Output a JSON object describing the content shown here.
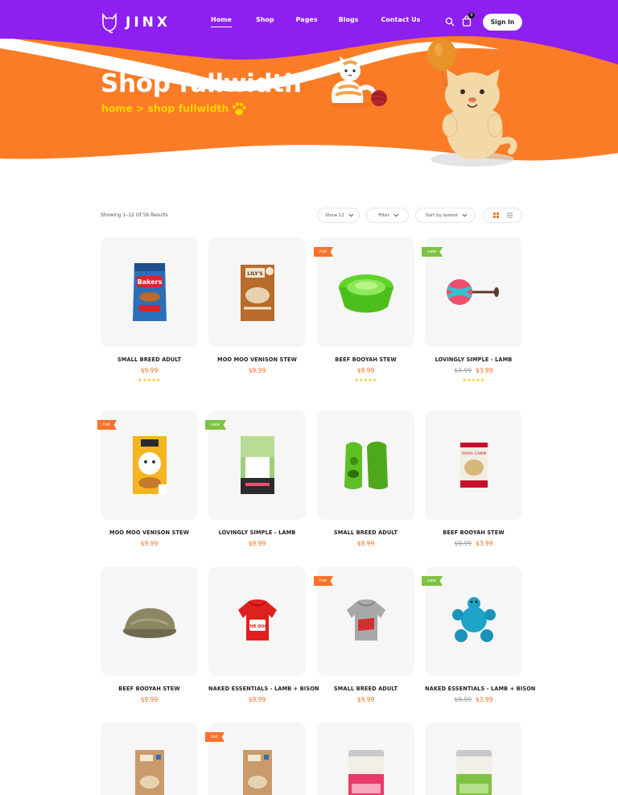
{
  "header": {
    "logo_text": "JINX",
    "nav": [
      {
        "label": "Home",
        "active": true
      },
      {
        "label": "Shop",
        "active": false
      },
      {
        "label": "Pages",
        "active": false
      },
      {
        "label": "Blogs",
        "active": false
      },
      {
        "label": "Contact Us",
        "active": false
      }
    ],
    "cart_count": "0",
    "signin_label": "Sign In"
  },
  "hero": {
    "title": "Shop fullwidth",
    "breadcrumb_home": "home",
    "breadcrumb_sep": ">",
    "breadcrumb_current": "shop fullwidth"
  },
  "toolbar": {
    "results_text": "Showing 1–12 Of 56 Results",
    "show_label": "Show 12",
    "filter_label": "Filter",
    "sort_label": "Sort by lastest"
  },
  "colors": {
    "purple": "#8d1ff0",
    "orange": "#fb7c26",
    "price": "#f26b1d",
    "hot": "#f7722a",
    "sale": "#7fc242",
    "star": "#f5c518"
  },
  "products": [
    {
      "name": "SMALL BREED ADULT",
      "price": "$9.99",
      "old_price": "",
      "tag": "",
      "stars": "★★★★★",
      "icon": "dog-food-bag-icon"
    },
    {
      "name": "MOO MOO VENISON STEW",
      "price": "$9.99",
      "old_price": "",
      "tag": "",
      "stars": "",
      "icon": "dog-food-bag-icon"
    },
    {
      "name": "BEEF BOOYAH STEW",
      "price": "$9.99",
      "old_price": "",
      "tag": "hot",
      "stars": "★★★★★",
      "icon": "pet-bowl-icon"
    },
    {
      "name": "LOVINGLY SIMPLE - LAMB",
      "price": "$3.99",
      "old_price": "$9.99",
      "tag": "sale",
      "stars": "★★★★★",
      "icon": "ball-toy-icon"
    },
    {
      "name": "MOO MOO VENISON STEW",
      "price": "$9.99",
      "old_price": "",
      "tag": "hot",
      "stars": "",
      "icon": "cat-food-bag-icon"
    },
    {
      "name": "LOVINGLY SIMPLE - LAMB",
      "price": "$9.99",
      "old_price": "",
      "tag": "sale",
      "stars": "",
      "icon": "dog-food-bag-icon"
    },
    {
      "name": "SMALL BREED ADULT",
      "price": "$9.99",
      "old_price": "",
      "tag": "",
      "stars": "",
      "icon": "pet-vest-icon"
    },
    {
      "name": "BEEF BOOYAH STEW",
      "price": "$3.99",
      "old_price": "$9.99",
      "tag": "",
      "stars": "",
      "icon": "dog-food-bag-icon"
    },
    {
      "name": "BEEF BOOYAH STEW",
      "price": "$9.99",
      "old_price": "",
      "tag": "",
      "stars": "",
      "icon": "pet-bed-icon"
    },
    {
      "name": "NAKED ESSENTIALS - LAMB + BISON",
      "price": "$9.99",
      "old_price": "",
      "tag": "",
      "stars": "",
      "icon": "dog-hoodie-icon"
    },
    {
      "name": "SMALL BREED ADULT",
      "price": "$9.99",
      "old_price": "",
      "tag": "hot",
      "stars": "",
      "icon": "dog-hoodie-icon"
    },
    {
      "name": "NAKED ESSENTIALS - LAMB + BISON",
      "price": "$3.99",
      "old_price": "$9.99",
      "tag": "sale",
      "stars": "",
      "icon": "plush-toy-icon"
    },
    {
      "name": "",
      "price": "",
      "old_price": "",
      "tag": "",
      "stars": "",
      "icon": "dog-food-bag-icon"
    },
    {
      "name": "",
      "price": "",
      "old_price": "",
      "tag": "hot",
      "stars": "",
      "icon": "dog-food-bag-icon"
    },
    {
      "name": "",
      "price": "",
      "old_price": "",
      "tag": "",
      "stars": "",
      "icon": "food-can-icon"
    },
    {
      "name": "",
      "price": "",
      "old_price": "",
      "tag": "",
      "stars": "",
      "icon": "food-can-icon"
    }
  ]
}
